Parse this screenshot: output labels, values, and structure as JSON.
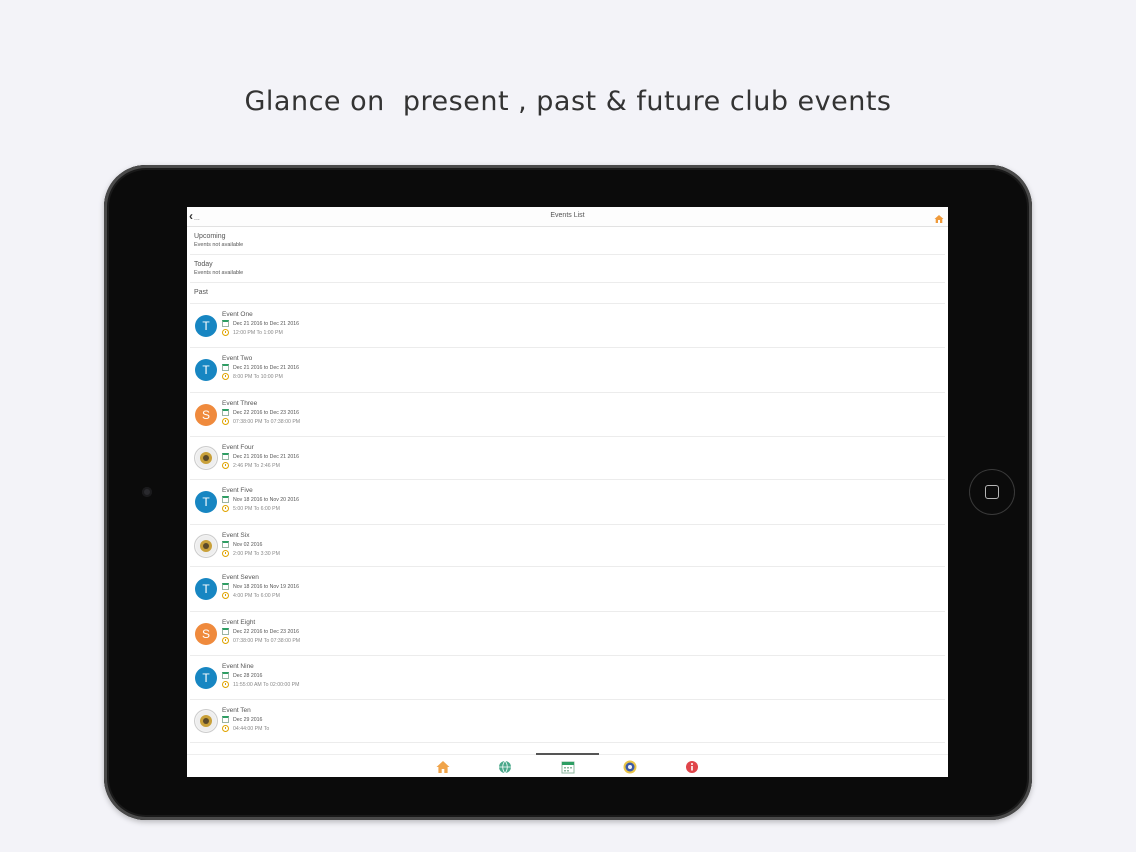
{
  "headline": "Glance on  present , past & future club events",
  "nav": {
    "back_label": "...",
    "title": "Events List"
  },
  "sections": {
    "upcoming": {
      "title": "Upcoming",
      "note": "Events not available"
    },
    "today": {
      "title": "Today",
      "note": "Events not available"
    },
    "past": {
      "title": "Past"
    }
  },
  "events": [
    {
      "name": "Event One",
      "dates": "Dec 21 2016 to Dec 21 2016",
      "time": "12:00 PM To 1:00 PM",
      "avatar": "T",
      "color": "#1786c2"
    },
    {
      "name": "Event Two",
      "dates": "Dec 21 2016 to Dec 21 2016",
      "time": "8:00 PM To 10:00 PM",
      "avatar": "T",
      "color": "#1786c2"
    },
    {
      "name": "Event Three",
      "dates": "Dec 22 2016 to Dec 23 2016",
      "time": "07:38:00 PM To 07:38:00 PM",
      "avatar": "S",
      "color": "#ef8a3d"
    },
    {
      "name": "Event Four",
      "dates": "Dec 21 2016 to Dec 21 2016",
      "time": "2:46 PM To 2:46 PM",
      "avatar": "",
      "color": ""
    },
    {
      "name": "Event Five",
      "dates": "Nov 18 2016 to Nov 20 2016",
      "time": "5:00 PM To 6:00 PM",
      "avatar": "T",
      "color": "#1786c2"
    },
    {
      "name": "Event Six",
      "dates": "Nov 02 2016",
      "time": "2:00 PM To 3:30 PM",
      "avatar": "",
      "color": ""
    },
    {
      "name": "Event Seven",
      "dates": "Nov 18 2016 to Nov 19 2016",
      "time": "4:00 PM To 6:00 PM",
      "avatar": "T",
      "color": "#1786c2"
    },
    {
      "name": "Event Eight",
      "dates": "Dec 22 2016 to Dec 23 2016",
      "time": "07:38:00 PM To 07:38:00 PM",
      "avatar": "S",
      "color": "#ef8a3d"
    },
    {
      "name": "Event Nine",
      "dates": "Dec 28 2016",
      "time": "11:55:00 AM To 02:00:00 PM",
      "avatar": "T",
      "color": "#1786c2"
    },
    {
      "name": "Event Ten",
      "dates": "Dec 29 2016",
      "time": "04:44:00 PM To",
      "avatar": "",
      "color": ""
    }
  ],
  "tabs": [
    {
      "icon": "home-icon"
    },
    {
      "icon": "globe-icon"
    },
    {
      "icon": "calendar-icon"
    },
    {
      "icon": "club-emblem-icon"
    },
    {
      "icon": "info-icon"
    }
  ],
  "active_tab": "calendar-icon"
}
